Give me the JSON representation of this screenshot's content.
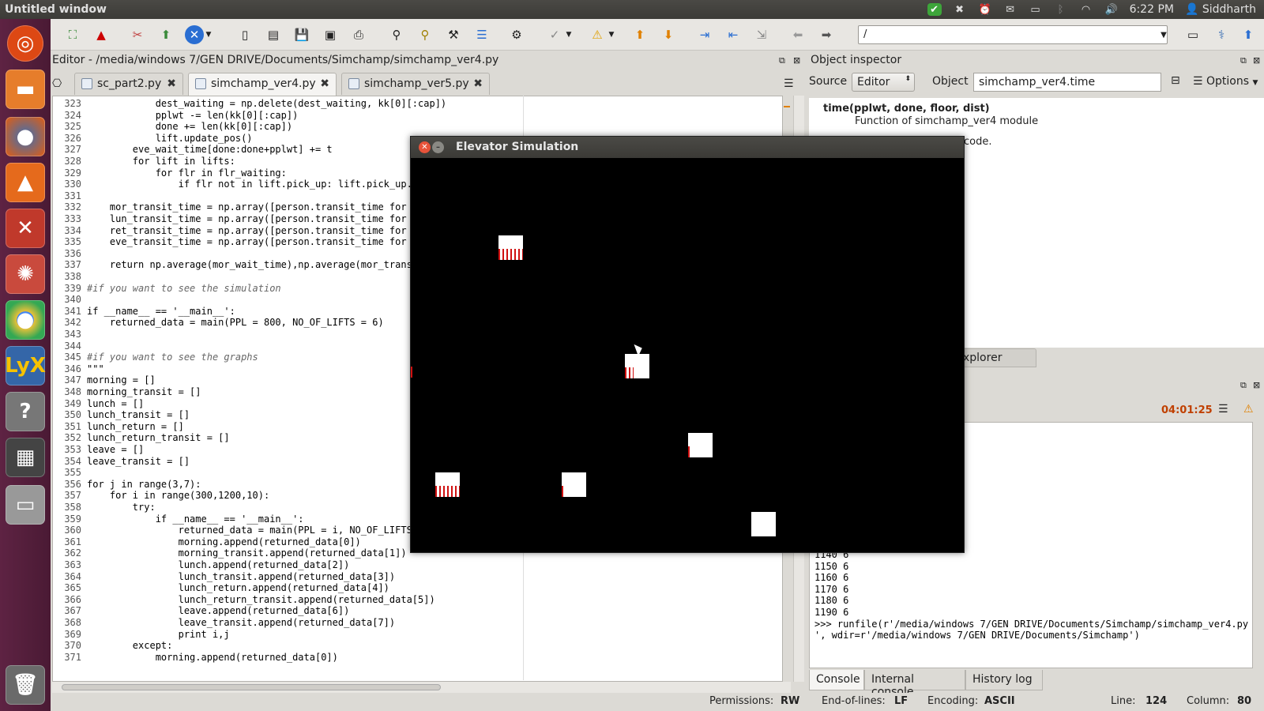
{
  "topbar": {
    "window_title": "Untitled window",
    "time": "6:22 PM",
    "user": "Siddharth"
  },
  "toolbar": {
    "path_value": "/"
  },
  "editor": {
    "title": "Editor - /media/windows 7/GEN DRIVE/Documents/Simchamp/simchamp_ver4.py",
    "tabs": [
      {
        "label": "sc_part2.py"
      },
      {
        "label": "simchamp_ver4.py"
      },
      {
        "label": "simchamp_ver5.py"
      }
    ],
    "line_numbers": [
      "323",
      "324",
      "325",
      "326",
      "327",
      "328",
      "329",
      "330",
      "331",
      "332",
      "333",
      "334",
      "335",
      "336",
      "337",
      "338",
      "339",
      "340",
      "341",
      "342",
      "343",
      "344",
      "345",
      "346",
      "347",
      "348",
      "349",
      "350",
      "351",
      "352",
      "353",
      "354",
      "355",
      "356",
      "357",
      "358",
      "359",
      "360",
      "361",
      "362",
      "363",
      "364",
      "365",
      "366",
      "367",
      "368",
      "369",
      "370",
      "371"
    ],
    "lines": [
      "            dest_waiting = np.delete(dest_waiting, kk[0][:cap])",
      "            pplwt -= len(kk[0][:cap])",
      "            done += len(kk[0][:cap])",
      "            lift.update_pos()",
      "        eve_wait_time[done:done+pplwt] += t",
      "        for lift in lifts:",
      "            for flr in flr_waiting:",
      "                if flr not in lift.pick_up: lift.pick_up.",
      "",
      "    mor_transit_time = np.array([person.transit_time for",
      "    lun_transit_time = np.array([person.transit_time for",
      "    ret_transit_time = np.array([person.transit_time for",
      "    eve_transit_time = np.array([person.transit_time for",
      "",
      "    return np.average(mor_wait_time),np.average(mor_trans",
      "",
      "#if you want to see the simulation",
      "",
      "if __name__ == '__main__':",
      "    returned_data = main(PPL = 800, NO_OF_LIFTS = 6)",
      "",
      "",
      "#if you want to see the graphs",
      "\"\"\"",
      "morning = []",
      "morning_transit = []",
      "lunch = []",
      "lunch_transit = []",
      "lunch_return = []",
      "lunch_return_transit = []",
      "leave = []",
      "leave_transit = []",
      "",
      "for j in range(3,7):",
      "    for i in range(300,1200,10):",
      "        try:",
      "            if __name__ == '__main__':",
      "                returned_data = main(PPL = i, NO_OF_LIFTS",
      "                morning.append(returned_data[0])",
      "                morning_transit.append(returned_data[1])",
      "                lunch.append(returned_data[2])",
      "                lunch_transit.append(returned_data[3])",
      "                lunch_return.append(returned_data[4])",
      "                lunch_return_transit.append(returned_data[5])",
      "                leave.append(returned_data[6])",
      "                leave_transit.append(returned_data[7])",
      "                print i,j",
      "        except:",
      "            morning.append(returned_data[0])"
    ]
  },
  "inspector": {
    "title": "Object inspector",
    "source_label": "Source",
    "source_value": "Editor",
    "object_label": "Object",
    "object_value": "simchamp_ver4.time",
    "options_label": "Options",
    "signature": "time(pplwt, done, floor, dist)",
    "doc_line": "Function of simchamp_ver4 module",
    "doc_tail": "code."
  },
  "explorer_tab": "xplorer",
  "console": {
    "timer": "04:01:25",
    "lines": [
      "1140 6",
      "1150 6",
      "1160 6",
      "1170 6",
      "1180 6",
      "1190 6",
      ">>> runfile(r'/media/windows 7/GEN DRIVE/Documents/Simchamp/simchamp_ver4.py",
      "', wdir=r'/media/windows 7/GEN DRIVE/Documents/Simchamp')"
    ],
    "tabs": [
      {
        "label": "Console"
      },
      {
        "label": "Internal console"
      },
      {
        "label": "History log"
      }
    ]
  },
  "status": {
    "permissions_label": "Permissions:",
    "permissions_value": "RW",
    "eol_label": "End-of-lines:",
    "eol_value": "LF",
    "encoding_label": "Encoding:",
    "encoding_value": "ASCII",
    "line_label": "Line:",
    "line_value": "124",
    "column_label": "Column:",
    "column_value": "80"
  },
  "simulation": {
    "title": "Elevator Simulation"
  },
  "colors": {
    "launcher": "#5e2343",
    "topbar": "#3c3b37",
    "accent": "#dd4814",
    "lift": "#ffffff",
    "passenger": "#d01010"
  }
}
